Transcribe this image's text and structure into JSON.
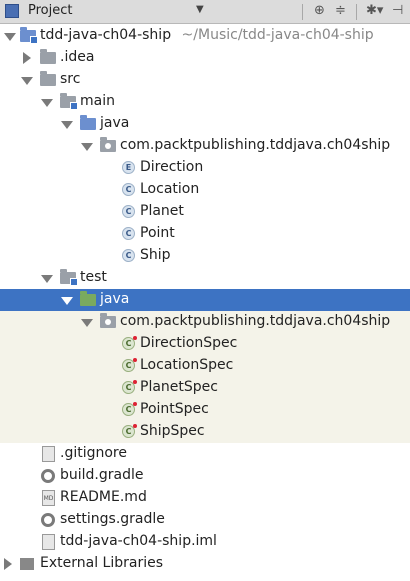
{
  "header": {
    "title": "Project",
    "dropdown_icon": "caret-down-icon",
    "buttons": [
      "target-icon",
      "collapse-icon",
      "gear-icon",
      "hide-icon"
    ]
  },
  "tree": {
    "root": {
      "label": "tdd-java-ch04-ship",
      "path": "~/Music/tdd-java-ch04-ship"
    },
    "idea": ".idea",
    "src": "src",
    "main": "main",
    "main_java": "java",
    "main_package": "com.packtpublishing.tddjava.ch04ship",
    "main_classes": [
      "Direction",
      "Location",
      "Planet",
      "Point",
      "Ship"
    ],
    "test": "test",
    "test_java": "java",
    "test_package": "com.packtpublishing.tddjava.ch04ship",
    "test_classes": [
      "DirectionSpec",
      "LocationSpec",
      "PlanetSpec",
      "PointSpec",
      "ShipSpec"
    ],
    "files": [
      ".gitignore",
      "build.gradle",
      "README.md",
      "settings.gradle",
      "tdd-java-ch04-ship.iml"
    ],
    "external": "External Libraries"
  },
  "colors": {
    "selection": "#3d73c3",
    "test_background": "#f4f3e9",
    "header": "#dcdcdc"
  }
}
